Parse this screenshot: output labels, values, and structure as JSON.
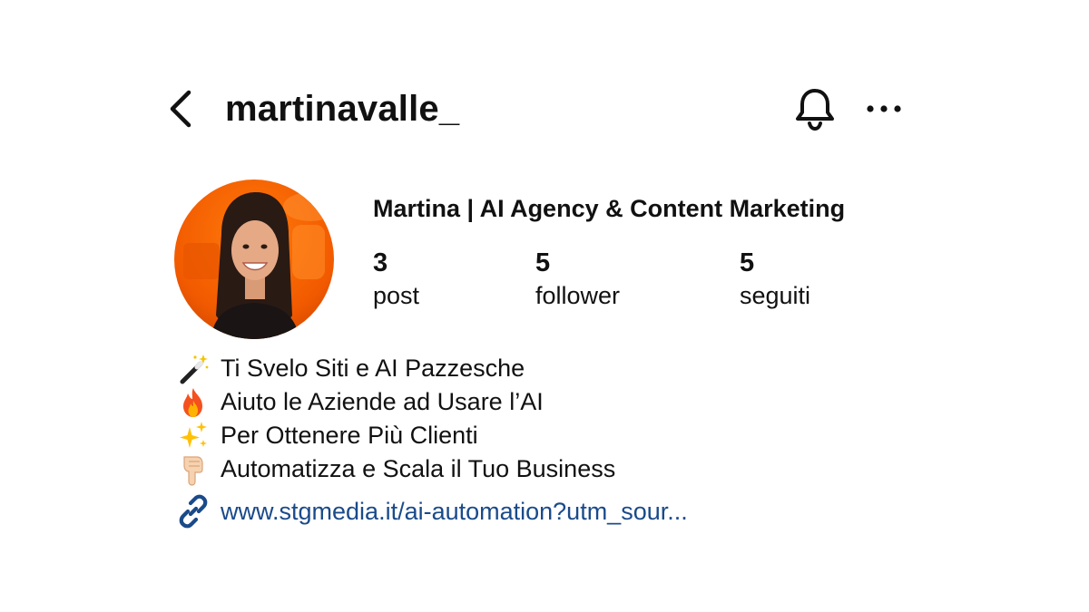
{
  "header": {
    "username": "martinavalle_",
    "back_icon": "chevron-left-icon",
    "bell_icon": "bell-icon",
    "more_icon": "more-horizontal-icon"
  },
  "profile": {
    "display_name": "Martina | AI Agency & Content Marketing",
    "avatar_icon": "avatar",
    "stats": [
      {
        "count": "3",
        "label": "post"
      },
      {
        "count": "5",
        "label": "follower"
      },
      {
        "count": "5",
        "label": "seguiti"
      }
    ]
  },
  "bio": {
    "lines": [
      {
        "emoji": "magic-wand-icon",
        "text": "Ti Svelo Siti e AI Pazzesche"
      },
      {
        "emoji": "fire-icon",
        "text": "Aiuto le Aziende ad Usare l’AI"
      },
      {
        "emoji": "sparkles-icon",
        "text": "Per Ottenere Più Clienti"
      },
      {
        "emoji": "pointing-down-icon",
        "text": "Automatizza e Scala il Tuo Business"
      }
    ],
    "link": {
      "icon": "link-icon",
      "text": "www.stgmedia.it/ai-automation?utm_sour...",
      "color": "#1a4a8a"
    }
  },
  "colors": {
    "text": "#111111",
    "link": "#1a4a8a",
    "avatar_bg": "#ff6a00"
  }
}
